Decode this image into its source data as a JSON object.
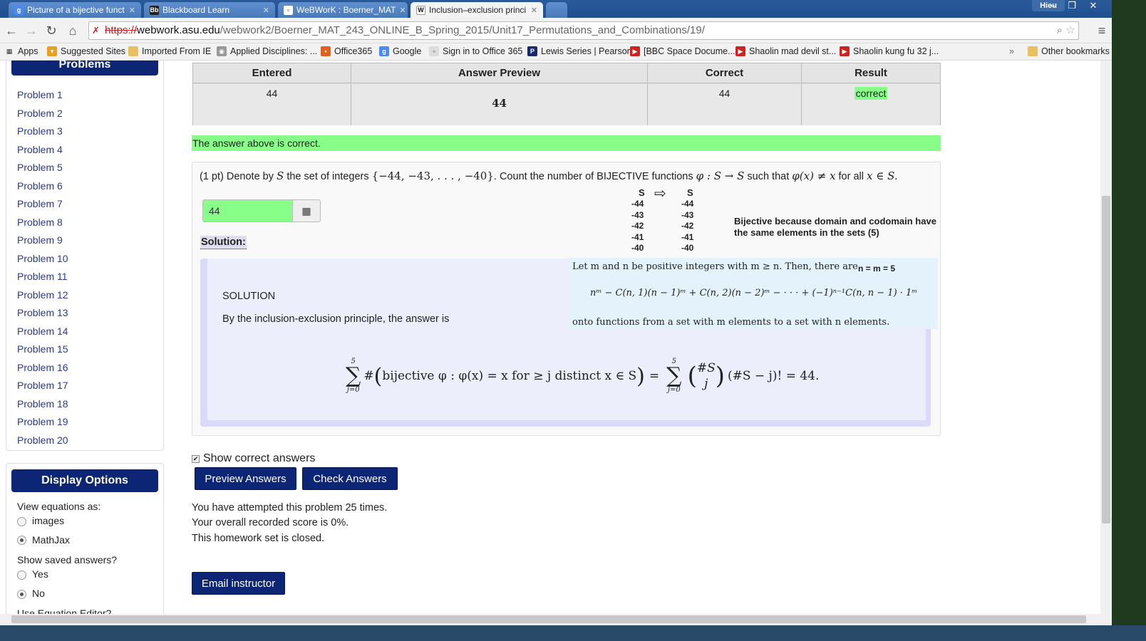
{
  "browser": {
    "tabs": [
      {
        "label": "Picture of a bijective funct",
        "active": false
      },
      {
        "label": "Blackboard Learn",
        "active": false
      },
      {
        "label": "WeBWorK : Boerner_MAT",
        "active": false
      },
      {
        "label": "Inclusion–exclusion princi",
        "active": true
      }
    ],
    "user": "Hieu",
    "url_scheme": "https://",
    "url_domain": "webwork.asu.edu",
    "url_path": "/webwork2/Boerner_MAT_243_ONLINE_B_Spring_2015/Unit17_Permutations_and_Combinations/19/",
    "bookmarks": [
      "Apps",
      "Suggested Sites",
      "Imported From IE",
      "Applied Disciplines: ...",
      "Office365",
      "Google",
      "Sign in to Office 365",
      "Lewis Series | Pearson",
      "[BBC Space Docume...",
      "Shaolin mad devil st...",
      "Shaolin kung fu 32 j..."
    ],
    "other_bookmarks": "Other bookmarks",
    "overflow": "»"
  },
  "sidebar": {
    "problems_title": "Problems",
    "problems": [
      "Problem 1",
      "Problem 2",
      "Problem 3",
      "Problem 4",
      "Problem 5",
      "Problem 6",
      "Problem 7",
      "Problem 8",
      "Problem 9",
      "Problem 10",
      "Problem 11",
      "Problem 12",
      "Problem 13",
      "Problem 14",
      "Problem 15",
      "Problem 16",
      "Problem 17",
      "Problem 18",
      "Problem 19",
      "Problem 20"
    ],
    "display_title": "Display Options",
    "view_equations_label": "View equations as:",
    "view_equations_options": [
      {
        "label": "images",
        "selected": false
      },
      {
        "label": "MathJax",
        "selected": true
      }
    ],
    "saved_answers_label": "Show saved answers?",
    "saved_answers_options": [
      {
        "label": "Yes",
        "selected": false
      },
      {
        "label": "No",
        "selected": true
      }
    ],
    "equation_editor_label": "Use Equation Editor?"
  },
  "results": {
    "headers": [
      "Entered",
      "Answer Preview",
      "Correct",
      "Result"
    ],
    "row": {
      "entered": "44",
      "preview": "44",
      "correct": "44",
      "result": "correct"
    }
  },
  "status_message": "The answer above is correct.",
  "problem": {
    "points": "(1 pt)",
    "text_1": "Denote by",
    "text_2": "the set of integers",
    "set_expr": "{−44, −43, . . . , −40}",
    "text_3": ". Count the number of BIJECTIVE functions",
    "func_expr": "φ : S → S",
    "text_4": "such that",
    "cond_expr": "φ(x) ≠ x",
    "text_5": "for all",
    "domain_expr": "x ∈ S.",
    "var_S": "S",
    "answer_value": "44",
    "solution_label": "Solution:",
    "solution_heading": "SOLUTION",
    "solution_desc": "By the inclusion-exclusion principle, the answer is",
    "formula": {
      "upper": "5",
      "lower": "j=0",
      "body_1": "#",
      "body_2": "bijective φ : φ(x) = x for  ≥ j distinct x ∈ S",
      "equals": "=",
      "binom_top": "#S",
      "binom_bottom": "j",
      "tail": "(#S − j)! = 44."
    }
  },
  "annotation": {
    "mapping_headers": [
      "S",
      "S"
    ],
    "mapping_left": [
      "-44",
      "-43",
      "-42",
      "-41",
      "-40"
    ],
    "mapping_right": [
      "-44",
      "-43",
      "-42",
      "-41",
      "-40"
    ],
    "bijective_note": "Bijective because domain and codomain have the same elements in the sets  (5)",
    "nm_note": "n = m = 5",
    "onto_intro": "Let m and n be positive integers with m ≥ n. Then, there are",
    "onto_formula": "nᵐ − C(n, 1)(n − 1)ᵐ + C(n, 2)(n − 2)ᵐ − · · · + (−1)ⁿ⁻¹C(n, n − 1) · 1ᵐ",
    "onto_outro": "onto functions from a set with m elements to a set with n elements."
  },
  "controls": {
    "show_correct_label": "Show correct answers",
    "show_correct_checked": true,
    "preview_button": "Preview Answers",
    "check_button": "Check Answers",
    "attempts": "You have attempted this problem 25 times.",
    "score": "Your overall recorded score is 0%.",
    "closed": "This homework set is closed.",
    "email_button": "Email instructor"
  }
}
